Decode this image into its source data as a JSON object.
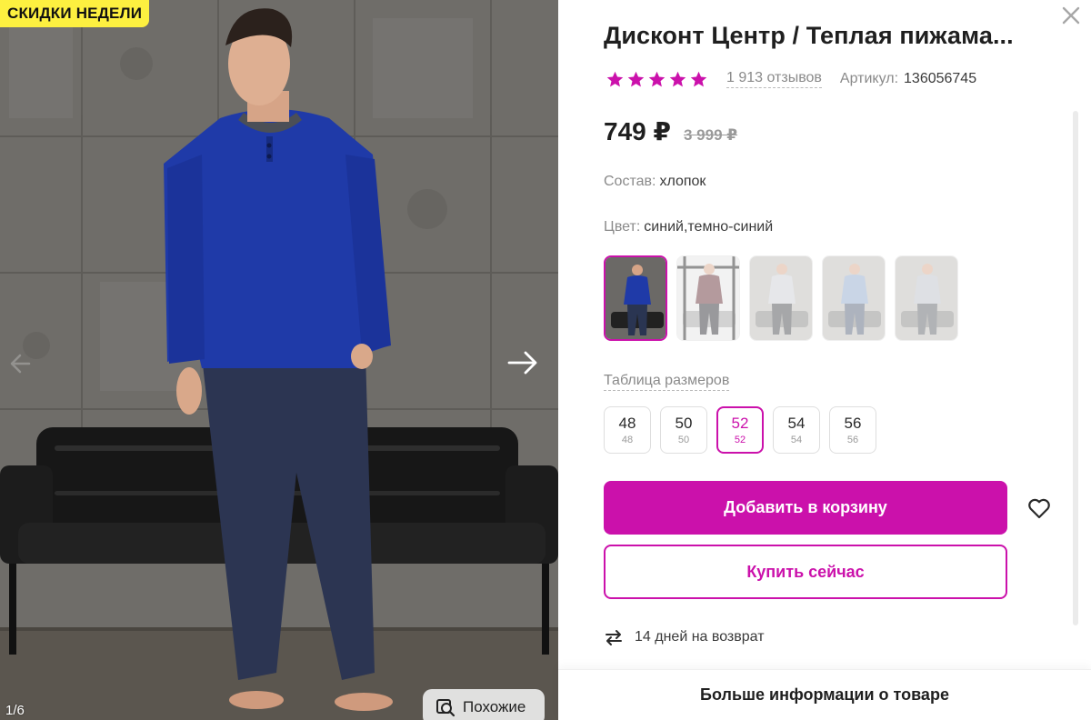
{
  "gallery": {
    "badge": "СКИДКИ НЕДЕЛИ",
    "counter": "1/6",
    "similar_label": "Похожие"
  },
  "product": {
    "title": "Дисконт Центр / Теплая пижама...",
    "rating_stars": 5,
    "reviews": "1 913 отзывов",
    "article_label": "Артикул:",
    "article_value": "136056745",
    "price": "749 ₽",
    "old_price": "3 999 ₽",
    "composition_label": "Состав:",
    "composition_value": "хлопок",
    "color_label": "Цвет:",
    "color_value": "синий,темно-синий",
    "color_variants": [
      {
        "name": "blue",
        "shirt": "#1f3aa8",
        "pants": "#2a3552",
        "selected": true
      },
      {
        "name": "burgundy",
        "shirt": "#5a2228",
        "pants": "#1e1f26",
        "selected": false
      },
      {
        "name": "light-gray",
        "shirt": "#c9ccd2",
        "pants": "#3b3d42",
        "selected": false
      },
      {
        "name": "light-blue",
        "shirt": "#8aa3c9",
        "pants": "#4b5870",
        "selected": false
      },
      {
        "name": "gray",
        "shirt": "#b8bcc4",
        "pants": "#55585f",
        "selected": false
      }
    ],
    "size_table_label": "Таблица размеров",
    "sizes": [
      {
        "label": "48",
        "sub": "48",
        "selected": false
      },
      {
        "label": "50",
        "sub": "50",
        "selected": false
      },
      {
        "label": "52",
        "sub": "52",
        "selected": true
      },
      {
        "label": "54",
        "sub": "54",
        "selected": false
      },
      {
        "label": "56",
        "sub": "56",
        "selected": false
      }
    ],
    "add_to_cart": "Добавить в корзину",
    "buy_now": "Купить сейчас",
    "returns": "14 дней на возврат",
    "more_info": "Больше информации о товаре"
  },
  "colors": {
    "accent": "#cb11ab",
    "badge": "#fdf040",
    "star": "#cb11ab"
  },
  "icons": [
    "close-icon",
    "star-icon",
    "arrow-right-icon",
    "arrow-left-icon",
    "similar-search-icon",
    "heart-icon",
    "return-arrows-icon"
  ]
}
